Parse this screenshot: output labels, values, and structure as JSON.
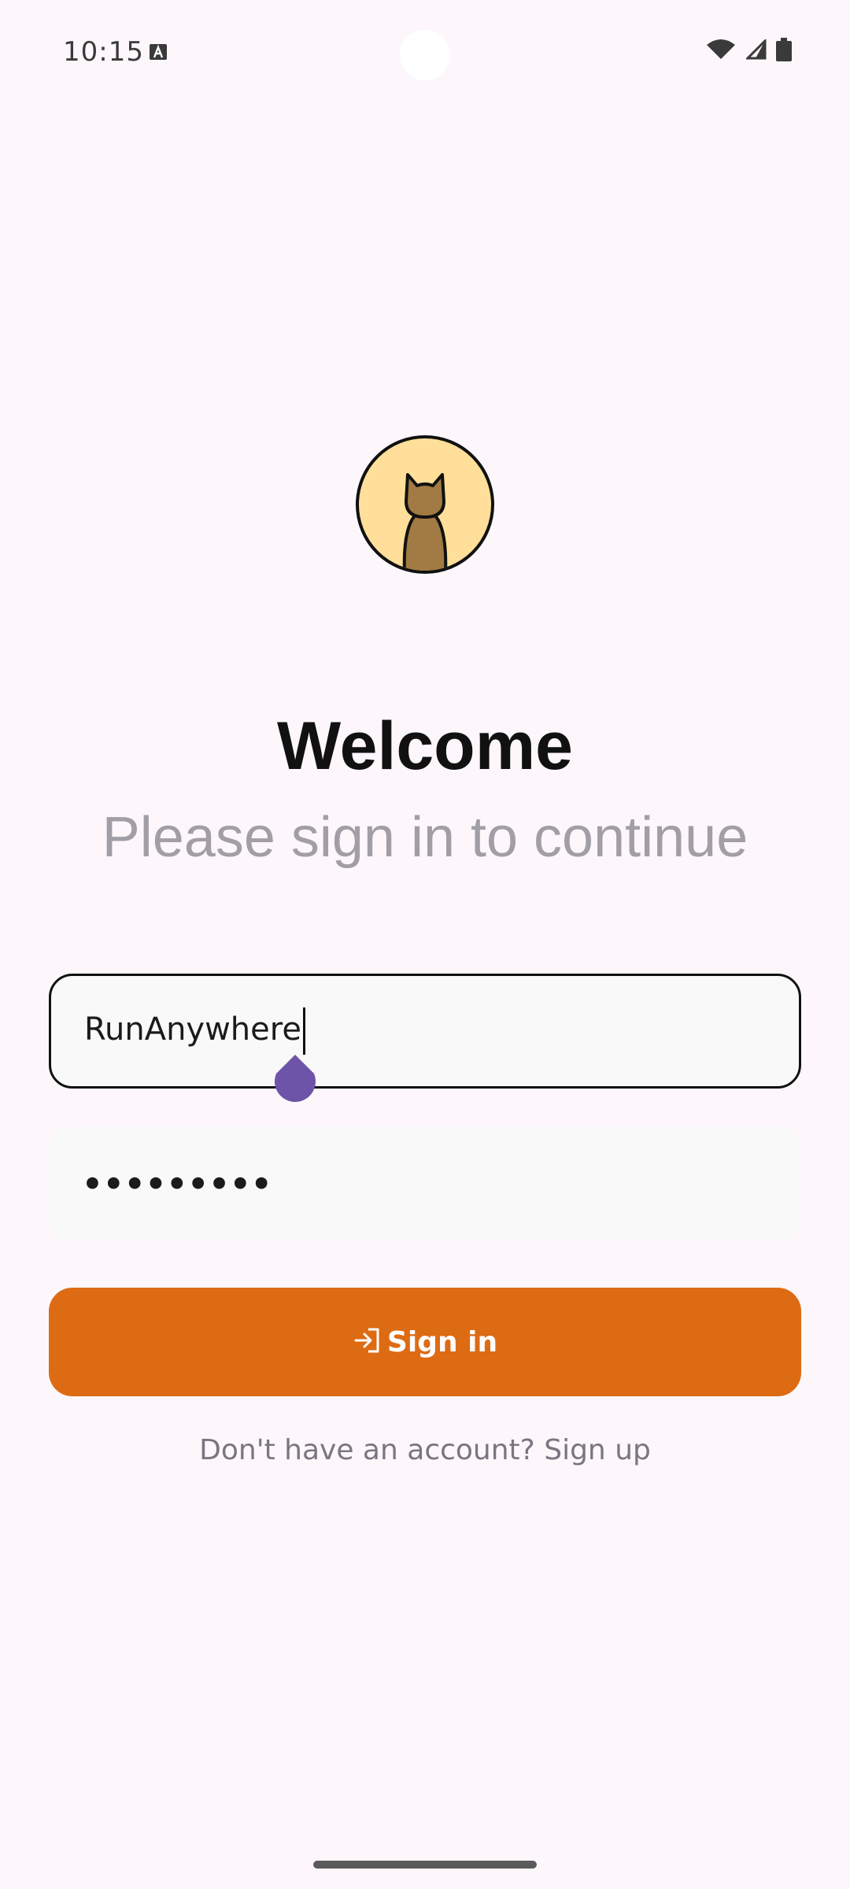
{
  "status_bar": {
    "time": "10:15",
    "icons": [
      "a-icon",
      "wifi-icon",
      "signal-icon",
      "battery-icon"
    ]
  },
  "avatar": {
    "icon": "cat-icon",
    "background": "#ffdf99"
  },
  "header": {
    "title": "Welcome",
    "subtitle": "Please sign in to continue"
  },
  "form": {
    "username_value": "RunAnywhere",
    "password_value": "•••••••••"
  },
  "actions": {
    "signin_label": "Sign in",
    "signin_icon": "login-icon",
    "signin_color": "#dd6b14",
    "signup_prompt": "Don't have an account? Sign up"
  }
}
